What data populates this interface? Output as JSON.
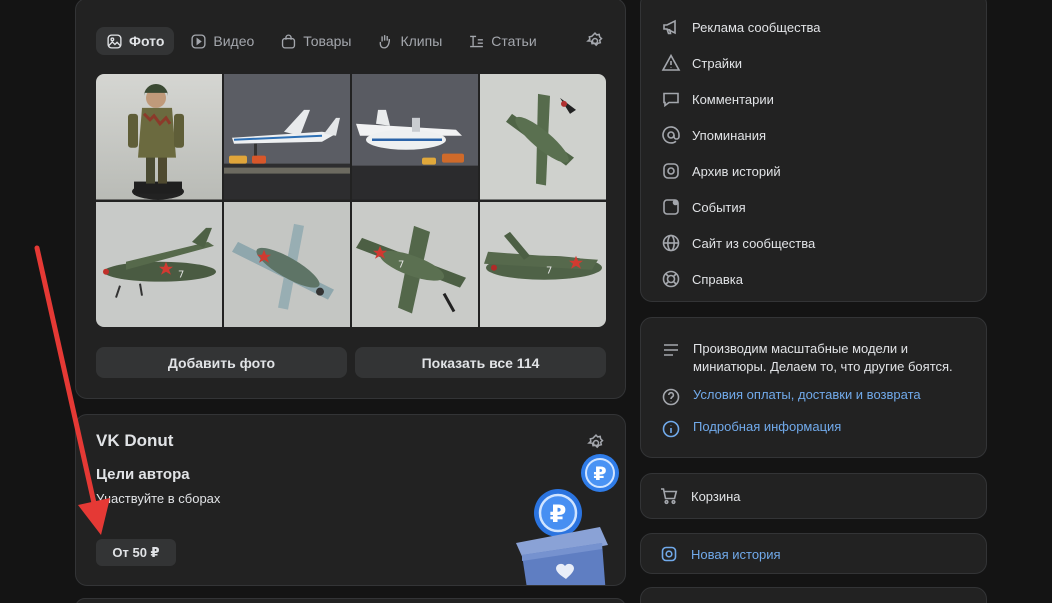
{
  "tabs": [
    {
      "label": "Фото",
      "icon": "photo-icon",
      "active": true
    },
    {
      "label": "Видео",
      "icon": "video-icon"
    },
    {
      "label": "Товары",
      "icon": "shopping-bag-icon"
    },
    {
      "label": "Клипы",
      "icon": "clips-icon"
    },
    {
      "label": "Статьи",
      "icon": "articles-icon"
    }
  ],
  "media": {
    "add_photo": "Добавить фото",
    "show_all": "Показать все 114"
  },
  "donut": {
    "title": "VK Donut",
    "goals_title": "Цели автора",
    "goals_subtitle": "Участвуйте в сборах",
    "from_button": "От 50 ₽",
    "coin_symbol": "₽"
  },
  "menu": {
    "items": [
      {
        "label": "Реклама сообщества",
        "icon": "megaphone-icon"
      },
      {
        "label": "Страйки",
        "icon": "warning-icon"
      },
      {
        "label": "Комментарии",
        "icon": "comment-icon"
      },
      {
        "label": "Упоминания",
        "icon": "at-icon"
      },
      {
        "label": "Архив историй",
        "icon": "story-archive-icon"
      },
      {
        "label": "События",
        "icon": "event-icon"
      },
      {
        "label": "Сайт из сообщества",
        "icon": "globe-icon"
      },
      {
        "label": "Справка",
        "icon": "help-icon"
      }
    ]
  },
  "info": {
    "description": "Производим масштабные модели и миниатюры. Делаем то, что другие боятся.",
    "terms_link": "Условия оплаты, доставки и возврата",
    "more_link": "Подробная информация"
  },
  "cart": {
    "label": "Корзина"
  },
  "story": {
    "label": "Новая история"
  },
  "colors": {
    "accent": "#71aaeb",
    "card": "#222222",
    "background": "#141414",
    "arrow": "#e53935"
  }
}
